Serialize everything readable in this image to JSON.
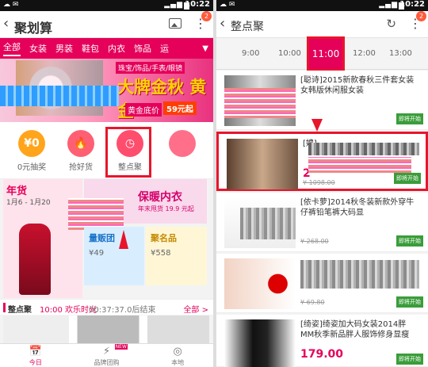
{
  "left": {
    "status_time": "10:22",
    "app_title": "聚划算",
    "badge_count": "2",
    "categories": [
      "全部",
      "女装",
      "男装",
      "鞋包",
      "内衣",
      "饰品",
      "运"
    ],
    "banner": {
      "tag": "珠宝/饰品/手表/眼镜",
      "headline": "大牌金秋 黄金",
      "sub": "黄金底价",
      "price": "59元起"
    },
    "quick_nav": [
      {
        "icon": "¥0",
        "label": "0元抽奖",
        "color": "#ffa41b"
      },
      {
        "icon": "🔥",
        "label": "抢好货",
        "color": "#ff5f73"
      },
      {
        "icon": "◷",
        "label": "整点聚",
        "color": "#ff4d6d"
      }
    ],
    "promos": {
      "p1_title": "年货",
      "p1_date": "1月6 - 1月20",
      "p2_title": "保暖内衣",
      "p2_sub": "年末甩货 19.9 元起",
      "p3_title": "量贩团",
      "p3_price": "¥49",
      "p4_title": "聚名品",
      "p4_price": "¥558"
    },
    "section": {
      "title": "整点聚",
      "slot": "10:00 欢乐时光",
      "countdown": "00:37:37.0后结束",
      "all": "全部 >"
    },
    "bottom_nav": [
      {
        "icon": "📅",
        "label": "今日"
      },
      {
        "icon": "⚡",
        "label": "品牌团购"
      },
      {
        "icon": "◎",
        "label": "本地"
      }
    ],
    "new_tag": "NEW"
  },
  "right": {
    "status_time": "10:22",
    "app_title": "整点聚",
    "badge_count": "2",
    "times": [
      "9:00",
      "10:00",
      "11:00",
      "12:00",
      "13:00"
    ],
    "items": [
      {
        "title": "[聪诗]2015新款春秋三件套女装女韩版休闲服女装",
        "price": "",
        "old": "",
        "btn": "即将开始"
      },
      {
        "title": "[娉]",
        "price": "2",
        "old": "¥ 1098.00",
        "btn": "即将开始"
      },
      {
        "title": "[依卡萝]2014秋冬装新款外穿牛仔裤铅笔裤大码显",
        "price": "",
        "old": "¥ 268.00",
        "btn": "即将开始"
      },
      {
        "title": "",
        "price": "",
        "old": "¥ 69.80",
        "btn": "即将开始"
      },
      {
        "title": "[绮姿]绮姿加大码女装2014胖MM秋季新品胖人服饰修身显瘦",
        "price": "179.00",
        "old": "",
        "btn": "即将开始"
      }
    ]
  }
}
